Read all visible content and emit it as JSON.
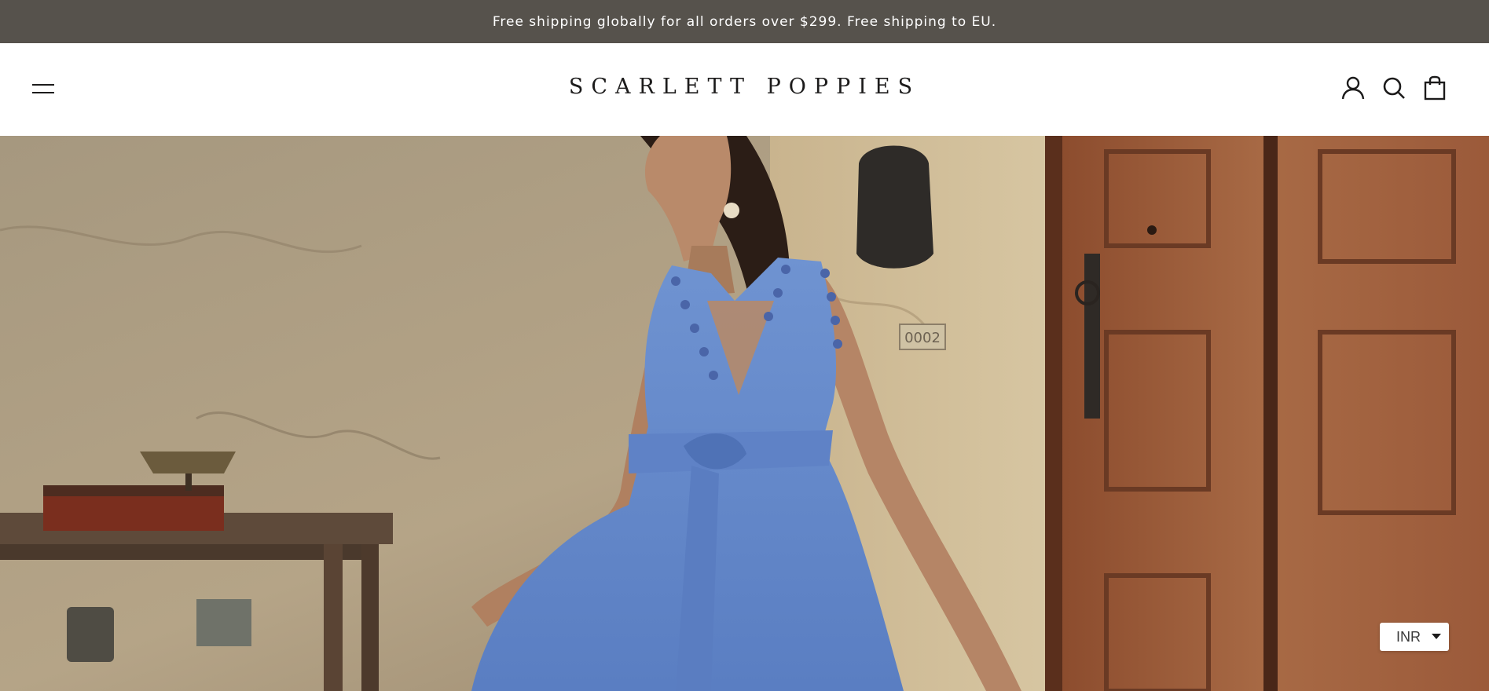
{
  "announcement": {
    "text": "Free shipping globally for all orders over $299. Free shipping to EU."
  },
  "header": {
    "logo": "SCARLETT POPPIES",
    "icons": [
      "hamburger-menu-icon",
      "account-icon",
      "search-icon",
      "cart-icon"
    ]
  },
  "hero": {
    "image": "model-in-blue-pom-pom-maxi-dress",
    "door_number": "0002"
  },
  "currency_selector": {
    "selected": "INR"
  },
  "colors": {
    "announcement_bg": "#56524c",
    "text_dark": "#1c1b1b",
    "background": "#ffffff"
  }
}
